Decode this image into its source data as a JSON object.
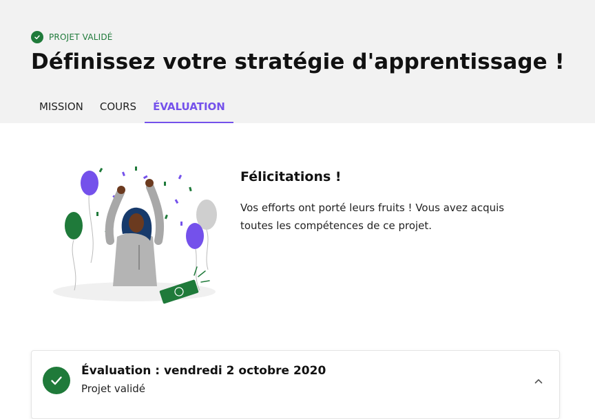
{
  "header": {
    "status_label": "PROJET VALIDÉ",
    "title": "Définissez votre stratégie d'apprentissage !",
    "tabs": [
      {
        "label": "MISSION",
        "active": false
      },
      {
        "label": "COURS",
        "active": false
      },
      {
        "label": "ÉVALUATION",
        "active": true
      }
    ]
  },
  "congrats": {
    "title": "Félicitations !",
    "text": "Vos efforts ont porté leurs fruits ! Vous avez acquis toutes les compétences de ce projet."
  },
  "evaluation": {
    "title": "Évaluation : vendredi 2 octobre 2020",
    "status": "Projet validé"
  },
  "colors": {
    "accent": "#7451eb",
    "success": "#1f7a3a",
    "header_bg": "#f2f2f2"
  },
  "icons": {
    "status": "check-circle-icon",
    "toggle": "chevron-up-icon"
  }
}
